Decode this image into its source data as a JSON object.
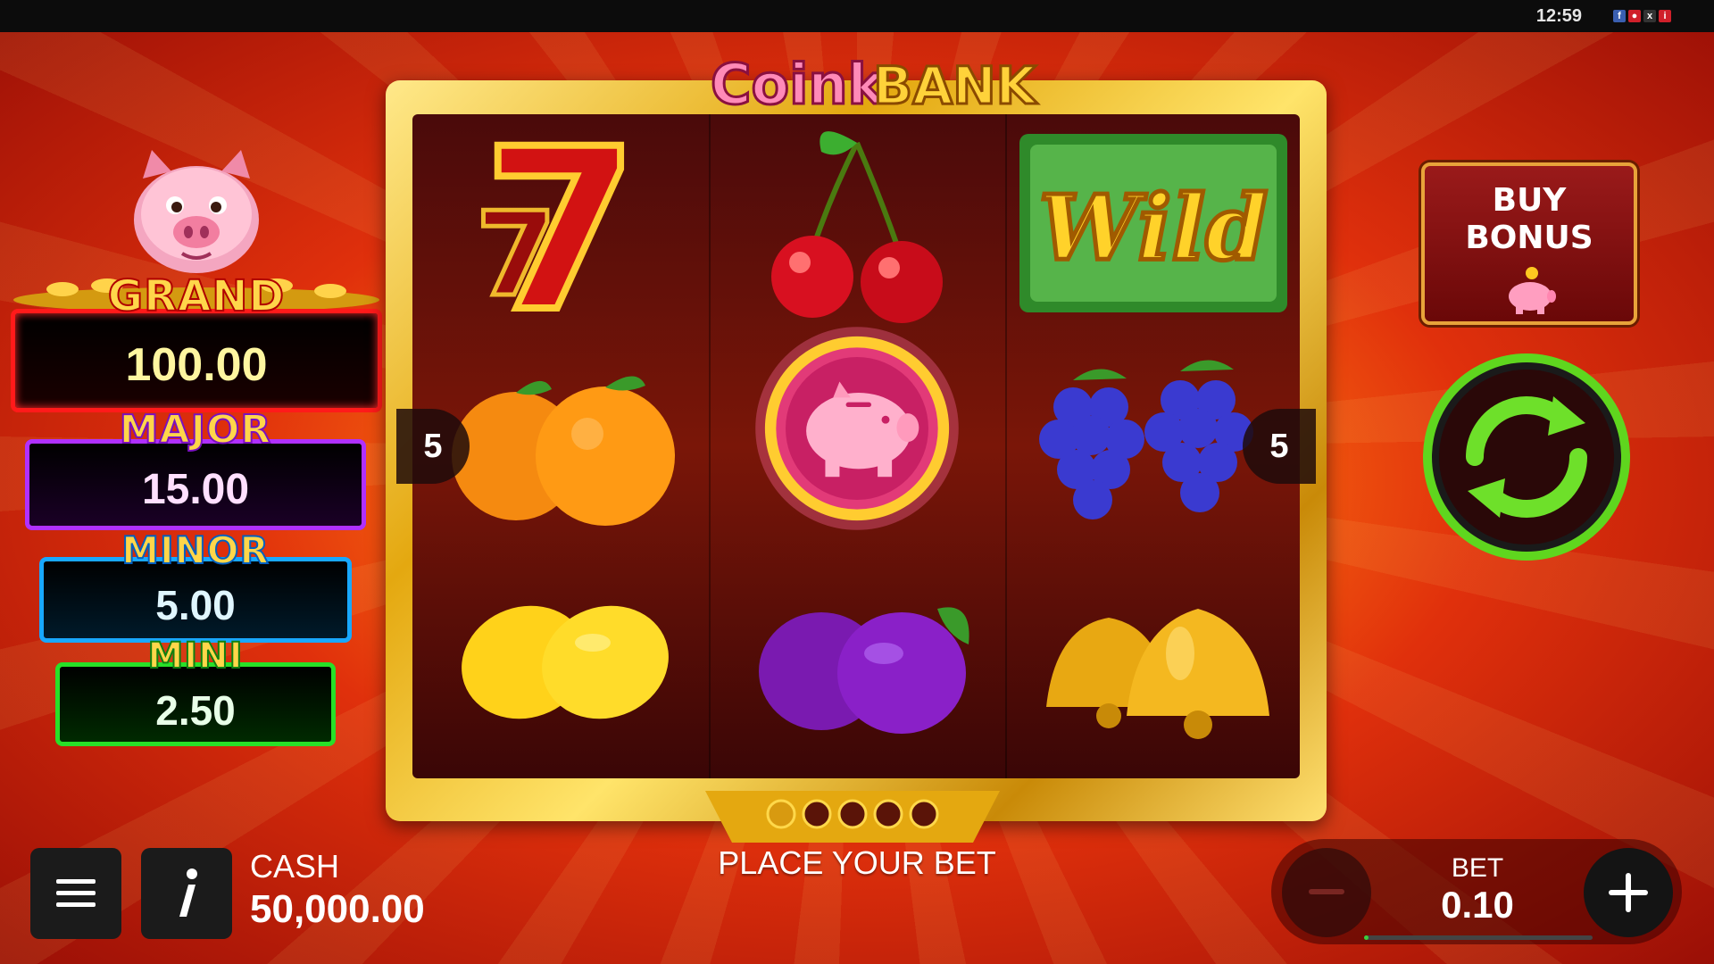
{
  "status_bar": {
    "time": "12:59",
    "icons": [
      "facebook-icon",
      "app-icon",
      "close-icon",
      "info-icon"
    ]
  },
  "game": {
    "logo_text_1": "Coink",
    "logo_text_2": "BANK"
  },
  "jackpots": [
    {
      "name": "GRAND",
      "value": "100.00",
      "color": "#ff1a1a",
      "title_color": "#ff3030"
    },
    {
      "name": "MAJOR",
      "value": "15.00",
      "color": "#b030ff",
      "title_color": "#c040ff"
    },
    {
      "name": "MINOR",
      "value": "5.00",
      "color": "#18a8ff",
      "title_color": "#28a0ff"
    },
    {
      "name": "MINI",
      "value": "2.50",
      "color": "#28e028",
      "title_color": "#40d020"
    }
  ],
  "reels": {
    "lines_left": "5",
    "lines_right": "5",
    "symbols": [
      [
        "seven",
        "cherry",
        "wild"
      ],
      [
        "orange",
        "piggy-bank-coin",
        "grapes"
      ],
      [
        "lemon",
        "plum",
        "bell"
      ]
    ],
    "wild_label": "Wild",
    "progress_dots": 5,
    "progress_filled": 1
  },
  "message": "PLACE YOUR BET",
  "buy_bonus": {
    "line1": "BUY",
    "line2": "BONUS"
  },
  "cash": {
    "label": "CASH",
    "value": "50,000.00"
  },
  "bet": {
    "label": "BET",
    "value": "0.10",
    "level_fraction": 0.02
  },
  "colors": {
    "gold": "#e4a810",
    "spin_green": "#5fd61e"
  }
}
